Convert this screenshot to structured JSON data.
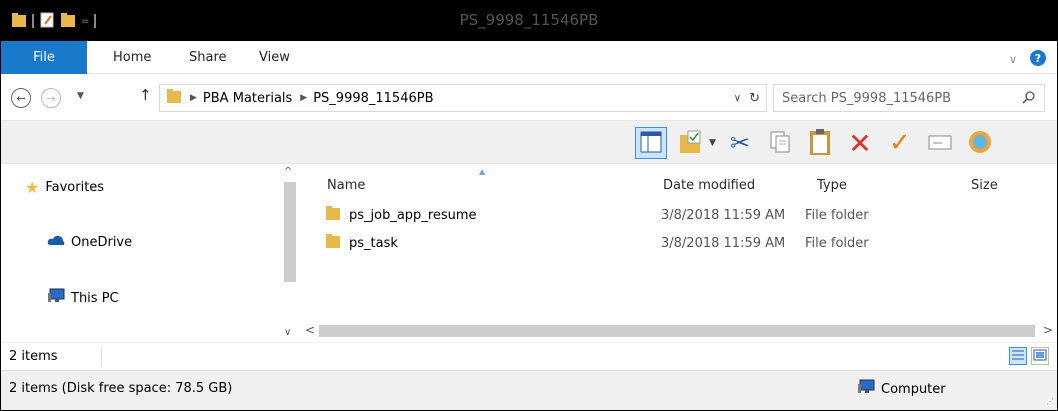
{
  "window": {
    "title": "PS_9998_11546PB"
  },
  "ribbon": {
    "tabs": [
      {
        "label": "File"
      },
      {
        "label": "Home"
      },
      {
        "label": "Share"
      },
      {
        "label": "View"
      }
    ]
  },
  "address": {
    "crumbs": [
      "PBA Materials",
      "PS_9998_11546PB"
    ]
  },
  "search": {
    "placeholder": "Search PS_9998_11546PB"
  },
  "navigation": {
    "items": [
      {
        "label": "Favorites",
        "icon": "star-icon"
      },
      {
        "label": "OneDrive",
        "icon": "cloud-icon"
      },
      {
        "label": "This PC",
        "icon": "computer-icon"
      }
    ]
  },
  "columns": {
    "name": "Name",
    "date": "Date modified",
    "type": "Type",
    "size": "Size"
  },
  "files": [
    {
      "name": "ps_job_app_resume",
      "date": "3/8/2018 11:59 AM",
      "type": "File folder"
    },
    {
      "name": "ps_task",
      "date": "3/8/2018 11:59 AM",
      "type": "File folder"
    }
  ],
  "status": {
    "item_count": "2 items",
    "disk_info": "2 items (Disk free space: 78.5 GB)",
    "location": "Computer"
  },
  "colors": {
    "accent": "#1979ca",
    "folder": "#e8b84a",
    "delete": "#e0302a",
    "check": "#f07c1a"
  }
}
